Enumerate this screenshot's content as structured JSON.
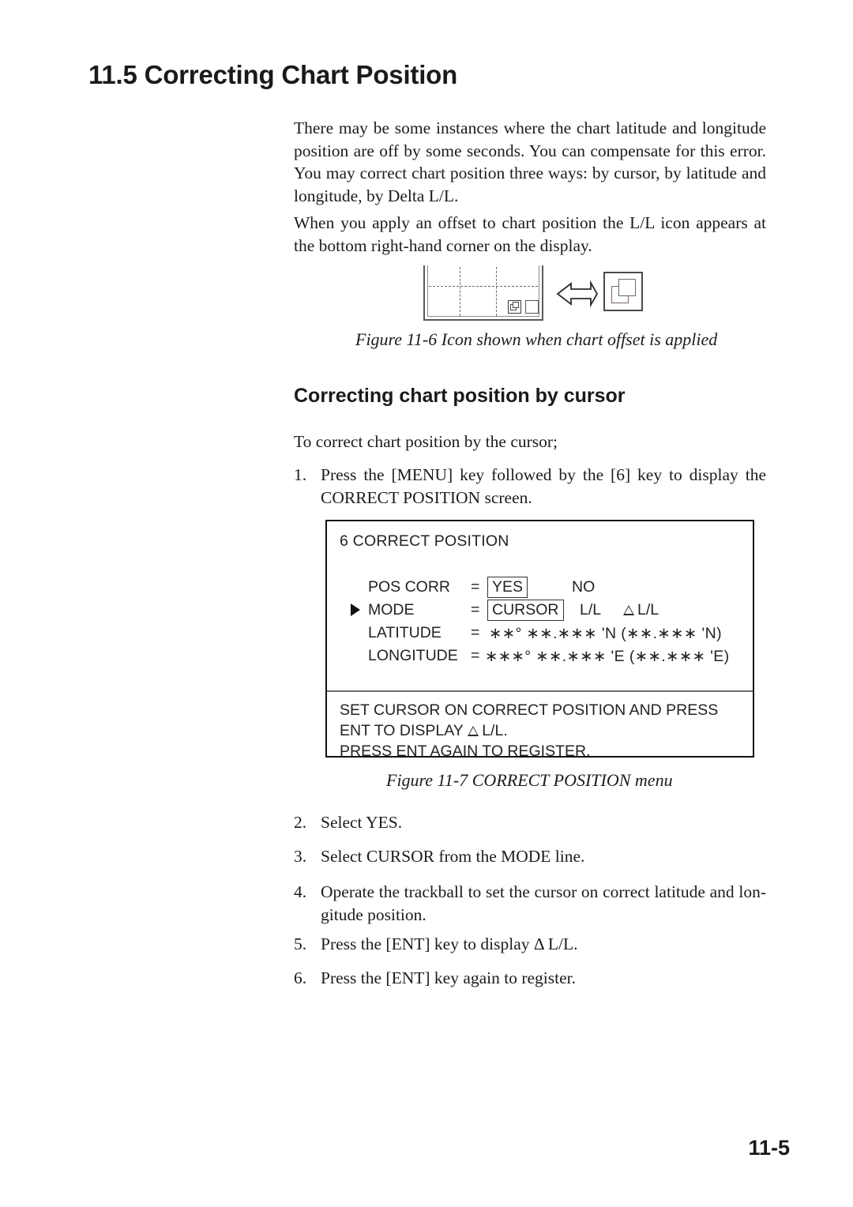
{
  "heading": {
    "section": "11.5 Correcting Chart Position",
    "subsection": "Correcting chart position by cursor"
  },
  "paragraphs": {
    "p1": "There may be some instances where the chart latitude and longitude position are off by some seconds. You can compensate for this error. You may correct chart position three ways: by cursor, by latitude and longitude, by Delta L/L.",
    "p2": "When you apply an offset to chart position the L/L icon appears at the bottom right-hand corner on the display.",
    "p3": "To correct chart position by the cursor;"
  },
  "figures": {
    "fig_11_6_caption": "Figure 11-6 Icon shown when chart offset is applied",
    "fig_11_7_caption": "Figure 11-7 CORRECT POSITION menu"
  },
  "steps": [
    {
      "num": "1.",
      "text": "Press the [MENU] key followed by the [6] key to display the CORRECT POSITION screen."
    },
    {
      "num": "2.",
      "text": "Select YES."
    },
    {
      "num": "3.",
      "text": "Select CURSOR from the MODE line."
    },
    {
      "num": "4.",
      "text": "Operate the trackball to set the cursor on correct latitude and lon-gitude position."
    },
    {
      "num": "5.",
      "text": "Press the [ENT] key to display Δ L/L."
    },
    {
      "num": "6.",
      "text": "Press the [ENT] key again to register."
    }
  ],
  "menu": {
    "title": "6 CORRECT POSITION",
    "rows": {
      "pos_corr": {
        "label": "POS CORR",
        "equals": "=",
        "selected": "YES",
        "alt": "NO"
      },
      "mode": {
        "label": "MODE",
        "equals": "=",
        "selected": "CURSOR",
        "alt1": "L/L",
        "alt2": "L/L"
      },
      "latitude": {
        "label": "LATITUDE",
        "equals": "=",
        "value": "∗∗° ∗∗.∗∗∗ 'N  (∗∗.∗∗∗ 'N)"
      },
      "longitude": {
        "label": "LONGITUDE",
        "equals": "=",
        "value": "∗∗∗° ∗∗.∗∗∗ 'E  (∗∗.∗∗∗ 'E)"
      }
    },
    "messages": [
      "SET CURSOR ON CORRECT POSITION AND PRESS",
      "ENT TO DISPLAY",
      "PRESS ENT AGAIN TO REGISTER."
    ],
    "message_delta_suffix": "L/L."
  },
  "page_number": "11-5",
  "colors": {
    "text": "#1a1a1a",
    "menu_border": "#111111",
    "grid_line": "#6b6b6b"
  }
}
